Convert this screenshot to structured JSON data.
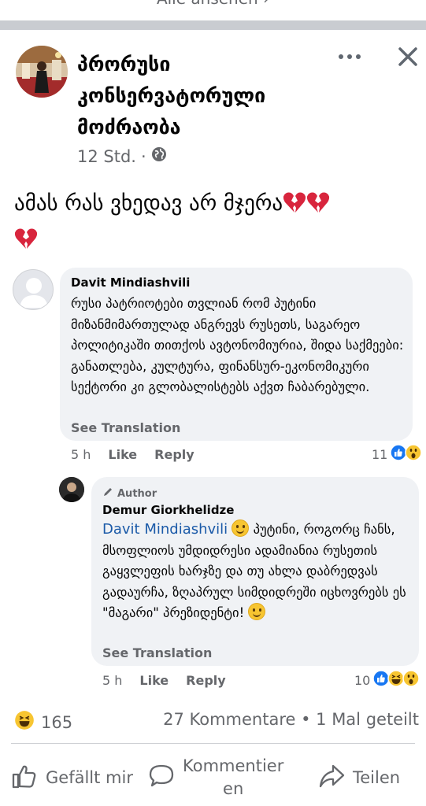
{
  "top": {
    "see_all": "Alle ansehen ›"
  },
  "post": {
    "page_name": "პრორუსი კონსერვატორული მოძრაობა",
    "time": "12 Std.",
    "dot": "·",
    "text": "ამას რას ვხედავ არ მჯერა",
    "icons": {
      "visibility": "globe-icon",
      "more": "more-icon",
      "close": "close-icon"
    }
  },
  "comments": [
    {
      "author": "Davit Mindiashvili",
      "text": "რუსი პატრიოტები თვლიან რომ პუტინი მიზანმიმართულად ანგრევს რუსეთს, საგარეო პოლიტიკაში თითქოს ავტონომიურია, შიდა საქმეები: განათლება, კულტურა, ფინანსურ-ეკონომიკური სექტორი კი გლობალისტებს აქვთ ჩაბარებული.",
      "see_translation": "See Translation",
      "time": "5 h",
      "like": "Like",
      "reply": "Reply",
      "reaction_count": "11"
    },
    {
      "badge": "Author",
      "author": "Demur Giorkhelidze",
      "mention": "Davit Mindiashvili",
      "text_part1": "პუტინი, როგორც ჩანს, მსოფლიოს უმდიდრესი ადამიანია რუსეთის გაყვლეფის ხარჯზე და თუ ახლა დაბრედვას გადაურჩა, ზღაპრულ სიმდიდრეში იცხოვრებს ეს \"მაგარი\" პრეზიდენტი!",
      "see_translation": "See Translation",
      "time": "5 h",
      "like": "Like",
      "reply": "Reply",
      "reaction_count": "10"
    }
  ],
  "summary": {
    "reaction_count": "165",
    "comments_shares": "27 Kommentare • 1 Mal geteilt"
  },
  "action_bar": {
    "like": "Gefällt mir",
    "comment_line1": "Kommentier",
    "comment_line2": "en",
    "share": "Teilen"
  },
  "colors": {
    "link": "#1b5aa8",
    "like_blue": "#1877f2",
    "emoji_yellow": "#f7c531",
    "muted": "#65676b",
    "bubble": "#f0f2f5"
  }
}
